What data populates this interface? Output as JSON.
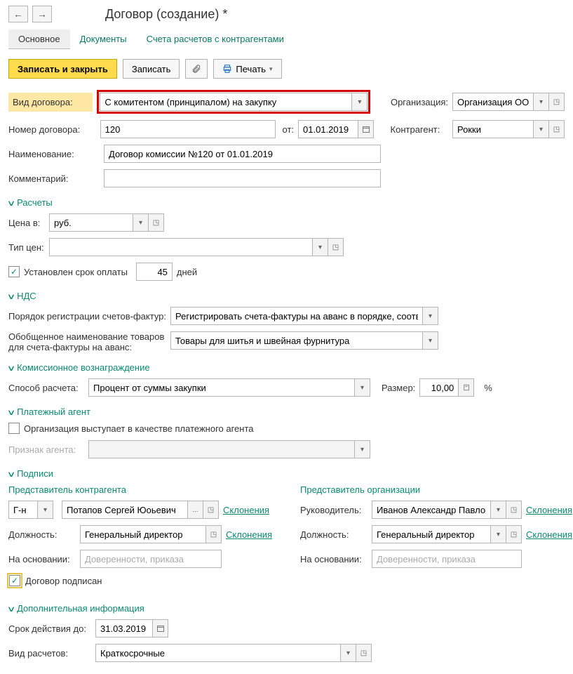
{
  "title": "Договор (создание) *",
  "tabs": {
    "main": "Основное",
    "docs": "Документы",
    "accounts": "Счета расчетов с контрагентами"
  },
  "toolbar": {
    "save_close": "Записать и закрыть",
    "save": "Записать",
    "print": "Печать"
  },
  "contract_type": {
    "label": "Вид договора:",
    "value": "С комитентом (принципалом) на закупку"
  },
  "org": {
    "label": "Организация:",
    "value": "Организация ООО"
  },
  "number": {
    "label": "Номер договора:",
    "value": "120",
    "from_label": "от:",
    "from_date": "01.01.2019"
  },
  "counterparty": {
    "label": "Контрагент:",
    "value": "Рокки"
  },
  "name": {
    "label": "Наименование:",
    "value": "Договор комиссии №120 от 01.01.2019"
  },
  "comment": {
    "label": "Комментарий:",
    "value": ""
  },
  "payments_hdr": "Расчеты",
  "price": {
    "label": "Цена в:",
    "value": "руб."
  },
  "price_type": {
    "label": "Тип цен:",
    "value": ""
  },
  "term": {
    "checked": true,
    "label": "Установлен срок оплаты",
    "days": "45",
    "days_label": "дней"
  },
  "vat_hdr": "НДС",
  "invoice_order": {
    "label": "Порядок регистрации счетов-фактур:",
    "value": "Регистрировать счета-фактуры на аванс в порядке, соответству"
  },
  "invoice_name": {
    "label1": "Обобщенное наименование товаров",
    "label2": "для счета-фактуры на аванс:",
    "value": "Товары для шитья и швейная фурнитура"
  },
  "commission_hdr": "Комиссионное вознаграждение",
  "calc": {
    "label": "Способ расчета:",
    "value": "Процент от суммы закупки",
    "size_label": "Размер:",
    "size_value": "10,00",
    "pct": "%"
  },
  "agent_hdr": "Платежный агент",
  "agent_chk": "Организация выступает в качестве платежного агента",
  "agent_sign": {
    "label": "Признак агента:",
    "value": ""
  },
  "sign_hdr": "Подписи",
  "rep_counter_hdr": "Представитель контрагента",
  "rep_org_hdr": "Представитель организации",
  "honorific": "Г-н",
  "rep_counter_name": "Потапов Сергей Юоьевич",
  "declension": "Склонения",
  "role_lbl": "Должность:",
  "role_counter": "Генеральный директор",
  "basis_lbl": "На основании:",
  "basis_ph": "Доверенности, приказа",
  "head_lbl": "Руководитель:",
  "head_name": "Иванов Александр Павлович",
  "role_org": "Генеральный директор",
  "signed_label": "Договор подписан",
  "extra_hdr": "Дополнительная информация",
  "valid_until": {
    "label": "Срок действия до:",
    "value": "31.03.2019"
  },
  "settle_type": {
    "label": "Вид расчетов:",
    "value": "Краткосрочные"
  }
}
